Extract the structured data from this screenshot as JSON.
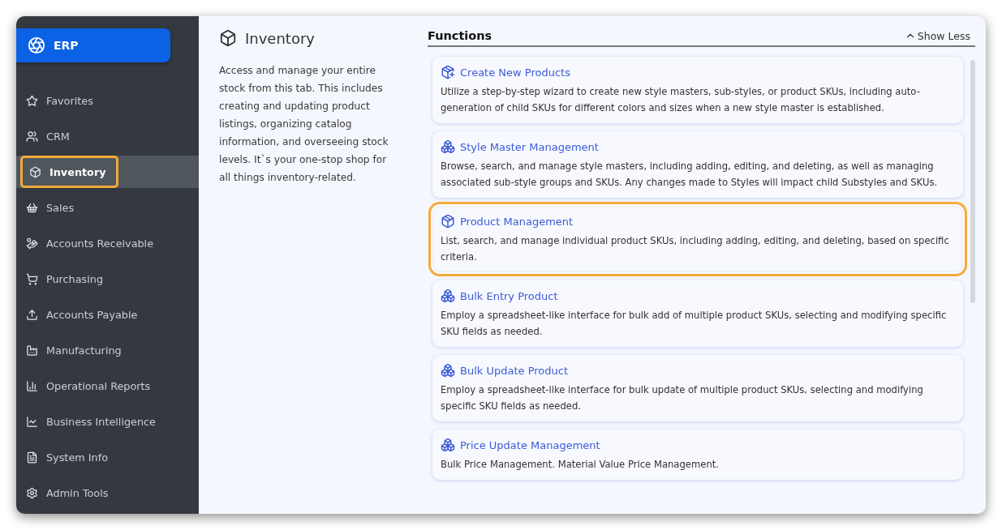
{
  "brand": {
    "label": "ERP"
  },
  "sidebar": {
    "items": [
      {
        "label": "Favorites",
        "selected": false
      },
      {
        "label": "CRM",
        "selected": false
      },
      {
        "label": "Inventory",
        "selected": true
      },
      {
        "label": "Sales",
        "selected": false
      },
      {
        "label": "Accounts Receivable",
        "selected": false
      },
      {
        "label": "Purchasing",
        "selected": false
      },
      {
        "label": "Accounts Payable",
        "selected": false
      },
      {
        "label": "Manufacturing",
        "selected": false
      },
      {
        "label": "Operational Reports",
        "selected": false
      },
      {
        "label": "Business Intelligence",
        "selected": false
      },
      {
        "label": "System Info",
        "selected": false
      },
      {
        "label": "Admin Tools",
        "selected": false
      }
    ]
  },
  "module": {
    "title": "Inventory",
    "description": "Access and manage your entire stock from this tab. This includes creating and updating product listings, organizing catalog information, and overseeing stock levels. It`s your one-stop shop for all things inventory-related."
  },
  "functions": {
    "title": "Functions",
    "toggle": "Show Less",
    "cards": [
      {
        "kind": "create",
        "title": "Create New Products",
        "description": "Utilize a step-by-step wizard to create new style masters, sub-styles, or product SKUs, including auto-generation of child SKUs for different colors and sizes when a new style master is established.",
        "selected": false
      },
      {
        "kind": "stack",
        "title": "Style Master Management",
        "description": "Browse, search, and manage style masters, including adding, editing, and deleting, as well as managing associated sub-style groups and SKUs. Any changes made to Styles will impact child Substyles and SKUs.",
        "selected": false
      },
      {
        "kind": "box",
        "title": "Product Management",
        "description": "List, search, and manage individual product SKUs, including adding, editing, and deleting, based on specific criteria.",
        "selected": true
      },
      {
        "kind": "bulk",
        "title": "Bulk Entry Product",
        "description": "Employ a spreadsheet-like interface for bulk add of multiple product SKUs, selecting and modifying specific SKU fields as needed.",
        "selected": false
      },
      {
        "kind": "bulk",
        "title": "Bulk Update Product",
        "description": "Employ a spreadsheet-like interface for bulk update of multiple product SKUs, selecting and modifying specific SKU fields as needed.",
        "selected": false
      },
      {
        "kind": "bulk",
        "title": "Price Update Management",
        "description": "Bulk Price Management. Material Value Price Management.",
        "selected": false
      }
    ]
  }
}
